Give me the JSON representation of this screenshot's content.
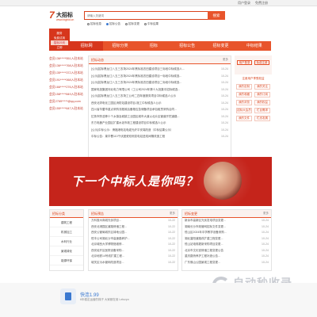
{
  "topbar": {
    "links": [
      "用户登录",
      "免费注册"
    ]
  },
  "logo": {
    "mark": "7",
    "name": "大招标",
    "url": "www.bigbid.cn"
  },
  "search": {
    "placeholder": "请输入关键词",
    "button": "搜索"
  },
  "radios": [
    {
      "label": "招标信息",
      "checked": false
    },
    {
      "label": "招标公告",
      "checked": true
    },
    {
      "label": "招标变更",
      "checked": false
    },
    {
      "label": "中标结果",
      "checked": false
    }
  ],
  "badge": {
    "line1": "服务",
    "line2": "免费试用",
    "line3": "招标20天",
    "line4": "立即"
  },
  "nav": [
    "招标网",
    "招标分类",
    "招标",
    "招标公告",
    "招标变更",
    "中标结果"
  ],
  "left_list": [
    "会员136*****551入驻本站",
    "会员136*****768入驻本站",
    "会员135*****372入驻本站",
    "会员191*****068入驻本站",
    "会员166*****276入驻本站",
    "会员158*****849入驻本站",
    "会员2769*****@qq.com",
    "会员155*****647入驻本站"
  ],
  "news": {
    "title": "招标动态",
    "more": "更多",
    "items": [
      {
        "text": "[公示]招标黑龙江八五三农场2024年黑标准农田建设项目三标段中标候选人...",
        "date": "10-24"
      },
      {
        "text": "[公示]招标黑龙江八五三农场2024年黑标准农田建设项目一标段中标候选...",
        "date": "10-24"
      },
      {
        "text": "[公示]招标黑龙江八五三农场2024年黑标准农田建设项目二标段中标候选...",
        "date": "10-24"
      },
      {
        "text": "国家电投集团河北电力有限公司（工公司2024年第十九批集中招标候选...",
        "date": "10-24"
      },
      {
        "text": "[公示]招标黑龙江八五三农场工公司二四年度服务项目中标候选人公示",
        "date": "10-24"
      },
      {
        "text": "西安北郊电化工园区消防站建设项目-施工中标候选人公示",
        "date": "10-24"
      },
      {
        "text": "四川省华蓥市重点采购流程政后备粮应急储备项目承包租赁采购合同...",
        "date": "10-24"
      },
      {
        "text": "拉鲁市陈浩等十个乡镇及城镇工业园区城市大道以北片区管道开挖道路...",
        "date": "10-24"
      },
      {
        "text": "东方电器产业园区扩建水泥市政工程建设项目中标候选人公示",
        "date": "10-24"
      },
      {
        "text": "[公示]中标公示：滑福港电站电缆光纤平安端改造（中标结果公示）",
        "date": "10-24"
      },
      {
        "text": "中标公告：莱华曹110千伏团瓷双侧变电站进线间隔改造工程",
        "date": "10-24"
      }
    ]
  },
  "right_panel": {
    "login": "用户登录",
    "register": "免费注册",
    "sub": "注册用户享受权益",
    "buttons": [
      "我的定制",
      "我的关注",
      "我的收藏",
      "我的订阅",
      "我的浏览",
      "我的权益",
      "招标大会员",
      "栏目需求",
      "我的文件",
      "栏态发展"
    ]
  },
  "banner": {
    "text": "下一个中标人是你吗？"
  },
  "categories": {
    "title": "招标分类",
    "items": [
      "建筑工程",
      "机械加工",
      "水利行业",
      "景观绿化",
      "能源环保"
    ]
  },
  "bid_notices": {
    "title": "招标预告",
    "more": "更多",
    "items": [
      {
        "text": "万科惠州商城光伏项目...",
        "date": "10-22"
      },
      {
        "text": "西安北港园区道路修缮工程...",
        "date": "10-22"
      },
      {
        "text": "西安公管局城东区绿地公园...",
        "date": "10-22"
      },
      {
        "text": "恒丰公司湖北沙市高速路养护...",
        "date": "10-22"
      },
      {
        "text": "北京城西大学博物馆维修...",
        "date": "10-22"
      },
      {
        "text": "西安经开区医院设备采购...",
        "date": "10-22"
      },
      {
        "text": "北京地铁14号线扩建工程...",
        "date": "10-22"
      },
      {
        "text": "城关区污水管网改造项目...",
        "date": "10-22"
      }
    ]
  },
  "bid_changes": {
    "title": "招标变更",
    "more": "更多",
    "items": [
      {
        "text": "新余市高新区光伏发电项目变更...",
        "date": "10-24"
      },
      {
        "text": "湖南长沙市政管网招标文件变更...",
        "date": "10-24"
      },
      {
        "text": "恒山区2024年中学教学设备采购...",
        "date": "10-24"
      },
      {
        "text": "湖北襄阳道路改扩建工程变更...",
        "date": "10-24"
      },
      {
        "text": "恒山站电梯更新采购项目变更...",
        "date": "10-24"
      },
      {
        "text": "北京市文化宫修缮工程变更公告",
        "date": "10-24"
      },
      {
        "text": "重庆路桥养护工程补遗公告...",
        "date": "10-24"
      },
      {
        "text": "广东佛山公园景观工程变更...",
        "date": "10-24"
      }
    ]
  },
  "watermark": {
    "text": "自动秒收录",
    "sub": "网 站 · 外 链 · 收 录"
  },
  "footer": {
    "title": "快连1.99",
    "desc": "6年稳定运营的梯子 大家都在用 Letsvpn"
  }
}
